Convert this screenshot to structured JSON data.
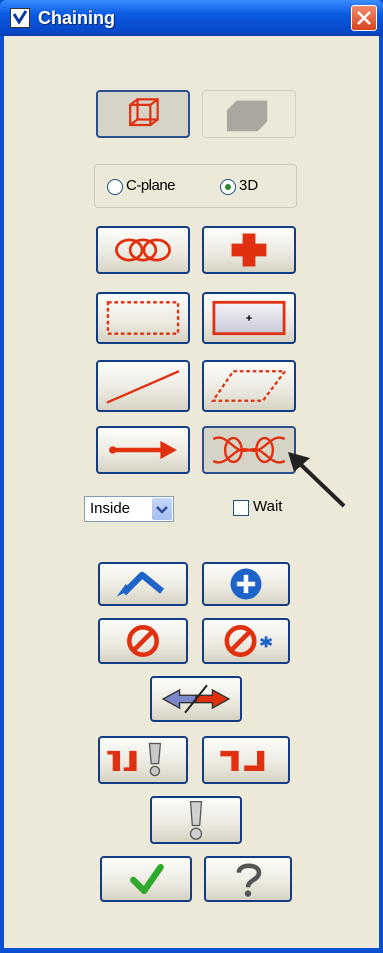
{
  "window": {
    "title": "Chaining",
    "close_icon": "close-icon",
    "app_icon": "checkbox-app-icon"
  },
  "mode_buttons": [
    {
      "name": "wireframe-mode",
      "icon": "wireframe-cube-icon",
      "pressed": true
    },
    {
      "name": "solid-mode",
      "icon": "solid-shape-icon",
      "enabled": false
    }
  ],
  "plane_options": {
    "cplane_label": "C-plane",
    "threed_label": "3D",
    "selected": "3D"
  },
  "chain_methods": [
    {
      "name": "chain",
      "icon": "chain-links-icon"
    },
    {
      "name": "point",
      "icon": "point-cross-icon"
    },
    {
      "name": "window",
      "icon": "dashed-window-icon"
    },
    {
      "name": "area",
      "icon": "area-point-icon"
    },
    {
      "name": "single",
      "icon": "single-line-icon"
    },
    {
      "name": "polygon",
      "icon": "dashed-polygon-icon"
    },
    {
      "name": "vector",
      "icon": "vector-arrow-icon"
    },
    {
      "name": "partial",
      "icon": "partial-chain-icon"
    }
  ],
  "window_selection": {
    "selected": "Inside",
    "wait_label": "Wait",
    "wait_checked": false
  },
  "colors": {
    "accent_red": "#e03010",
    "border_blue": "#123d84",
    "window_blue": "#0a4fd2",
    "dialog_bg": "#ece9d8",
    "ok_green": "#2eaa2e"
  }
}
